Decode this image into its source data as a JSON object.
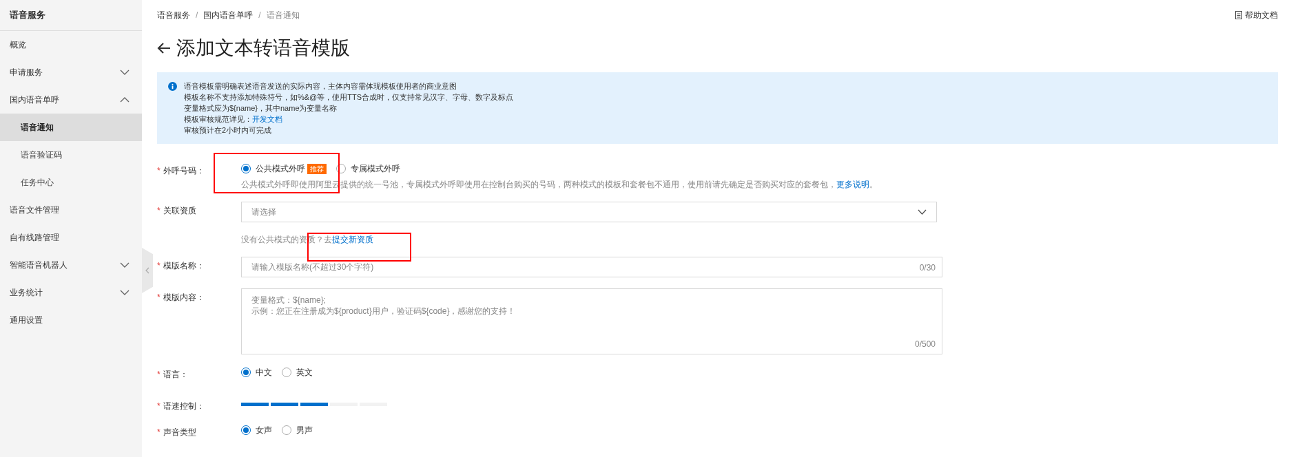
{
  "sidebar": {
    "title": "语音服务",
    "items": [
      {
        "label": "概览"
      },
      {
        "label": "申请服务",
        "expanded": false
      },
      {
        "label": "国内语音单呼",
        "expanded": true,
        "children": [
          {
            "label": "语音通知",
            "selected": true
          },
          {
            "label": "语音验证码",
            "selected": false
          },
          {
            "label": "任务中心",
            "selected": false
          }
        ]
      },
      {
        "label": "语音文件管理"
      },
      {
        "label": "自有线路管理"
      },
      {
        "label": "智能语音机器人",
        "expanded": false
      },
      {
        "label": "业务统计",
        "expanded": false
      },
      {
        "label": "通用设置"
      }
    ]
  },
  "breadcrumb": [
    "语音服务",
    "国内语音单呼",
    "语音通知"
  ],
  "breadcrumb_separator": "/",
  "help_link": "帮助文档",
  "title": "添加文本转语音模版",
  "notice": [
    {
      "text": "语音模板需明确表述语音发送的实际内容，主体内容需体现模板使用者的商业意图"
    },
    {
      "text": "模板名称不支持添加特殊符号，如%&@等，使用TTS合成时，仅支持常见汉字、字母、数字及标点"
    },
    {
      "text": "变量格式应为${name}，其中name为变量名称"
    },
    {
      "text": "模板审核规范详见：",
      "link": "开发文档"
    },
    {
      "text": "审核预计在2小时内可完成"
    }
  ],
  "form": [
    {
      "kind": "radio",
      "label": "外呼号码：",
      "required_mark": "*",
      "options": [
        {
          "label": "公共模式外呼",
          "selected": true,
          "badge": "推荐"
        },
        {
          "label": "专属模式外呼",
          "selected": false
        }
      ],
      "help": "公共模式外呼即使用阿里云提供的统一号池，专属模式外呼即使用在控制台购买的号码，两种模式的模板和套餐包不通用，使用前请先确定是否购买对应的套餐包，",
      "help_link": "更多说明",
      "help_end": "。"
    },
    {
      "kind": "select",
      "label": "关联资质",
      "required_mark": "*",
      "placeholder": "请选择",
      "help": "没有公共模式的资质？去",
      "help_link": "提交新资质"
    },
    {
      "kind": "text",
      "label": "模版名称：",
      "required_mark": "*",
      "placeholder": "请输入模版名称(不超过30个字符)",
      "counter": "0/30"
    },
    {
      "kind": "textarea",
      "label": "模版内容：",
      "required_mark": "*",
      "placeholder": "变量格式：${name};\n示例：您正在注册成为${product}用户，验证码${code}，感谢您的支持！",
      "counter": "0/500"
    },
    {
      "kind": "radio",
      "label": "语言：",
      "required_mark": "*",
      "options": [
        {
          "label": "中文",
          "selected": true
        },
        {
          "label": "英文",
          "selected": false
        }
      ]
    },
    {
      "kind": "slider",
      "label": "语速控制：",
      "required_mark": "*",
      "level": 0.6
    },
    {
      "kind": "radio",
      "label": "声音类型",
      "required_mark": "*",
      "options": [
        {
          "label": "女声",
          "selected": true
        },
        {
          "label": "男声",
          "selected": false
        }
      ]
    }
  ]
}
